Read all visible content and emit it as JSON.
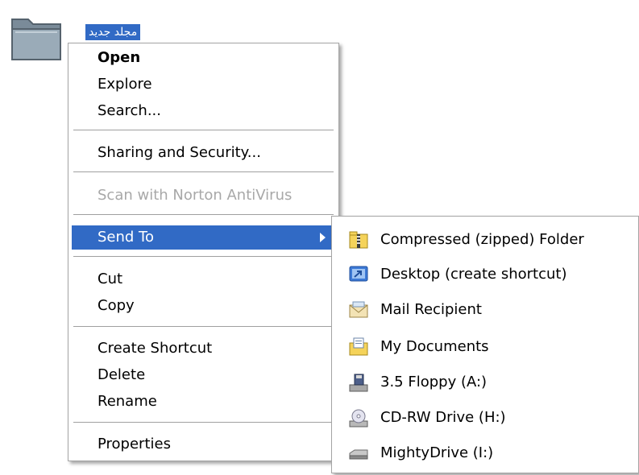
{
  "desktop": {
    "folder_label": "مجلد جديد"
  },
  "context_menu": {
    "items": [
      {
        "label": "Open",
        "bold": true
      },
      {
        "label": "Explore"
      },
      {
        "label": "Search..."
      },
      {
        "label": "Sharing and Security..."
      },
      {
        "label": "Scan with Norton AntiVirus",
        "disabled": true
      },
      {
        "label": "Send To",
        "highlighted": true,
        "has_submenu": true
      },
      {
        "label": "Cut"
      },
      {
        "label": "Copy"
      },
      {
        "label": "Create Shortcut"
      },
      {
        "label": "Delete"
      },
      {
        "label": "Rename"
      },
      {
        "label": "Properties"
      }
    ]
  },
  "send_to": {
    "items": [
      {
        "label": "Compressed (zipped) Folder",
        "icon": "zip-folder-icon"
      },
      {
        "label": "Desktop (create shortcut)",
        "icon": "desktop-shortcut-icon"
      },
      {
        "label": "Mail Recipient",
        "icon": "mail-icon"
      },
      {
        "label": "My Documents",
        "icon": "documents-folder-icon"
      },
      {
        "label": "3.5 Floppy (A:)",
        "icon": "floppy-drive-icon"
      },
      {
        "label": "CD-RW Drive (H:)",
        "icon": "cd-drive-icon"
      },
      {
        "label": "MightyDrive (I:)",
        "icon": "removable-drive-icon"
      }
    ]
  },
  "colors": {
    "highlight": "#316ac5",
    "disabled_text": "#a8a8a8"
  }
}
